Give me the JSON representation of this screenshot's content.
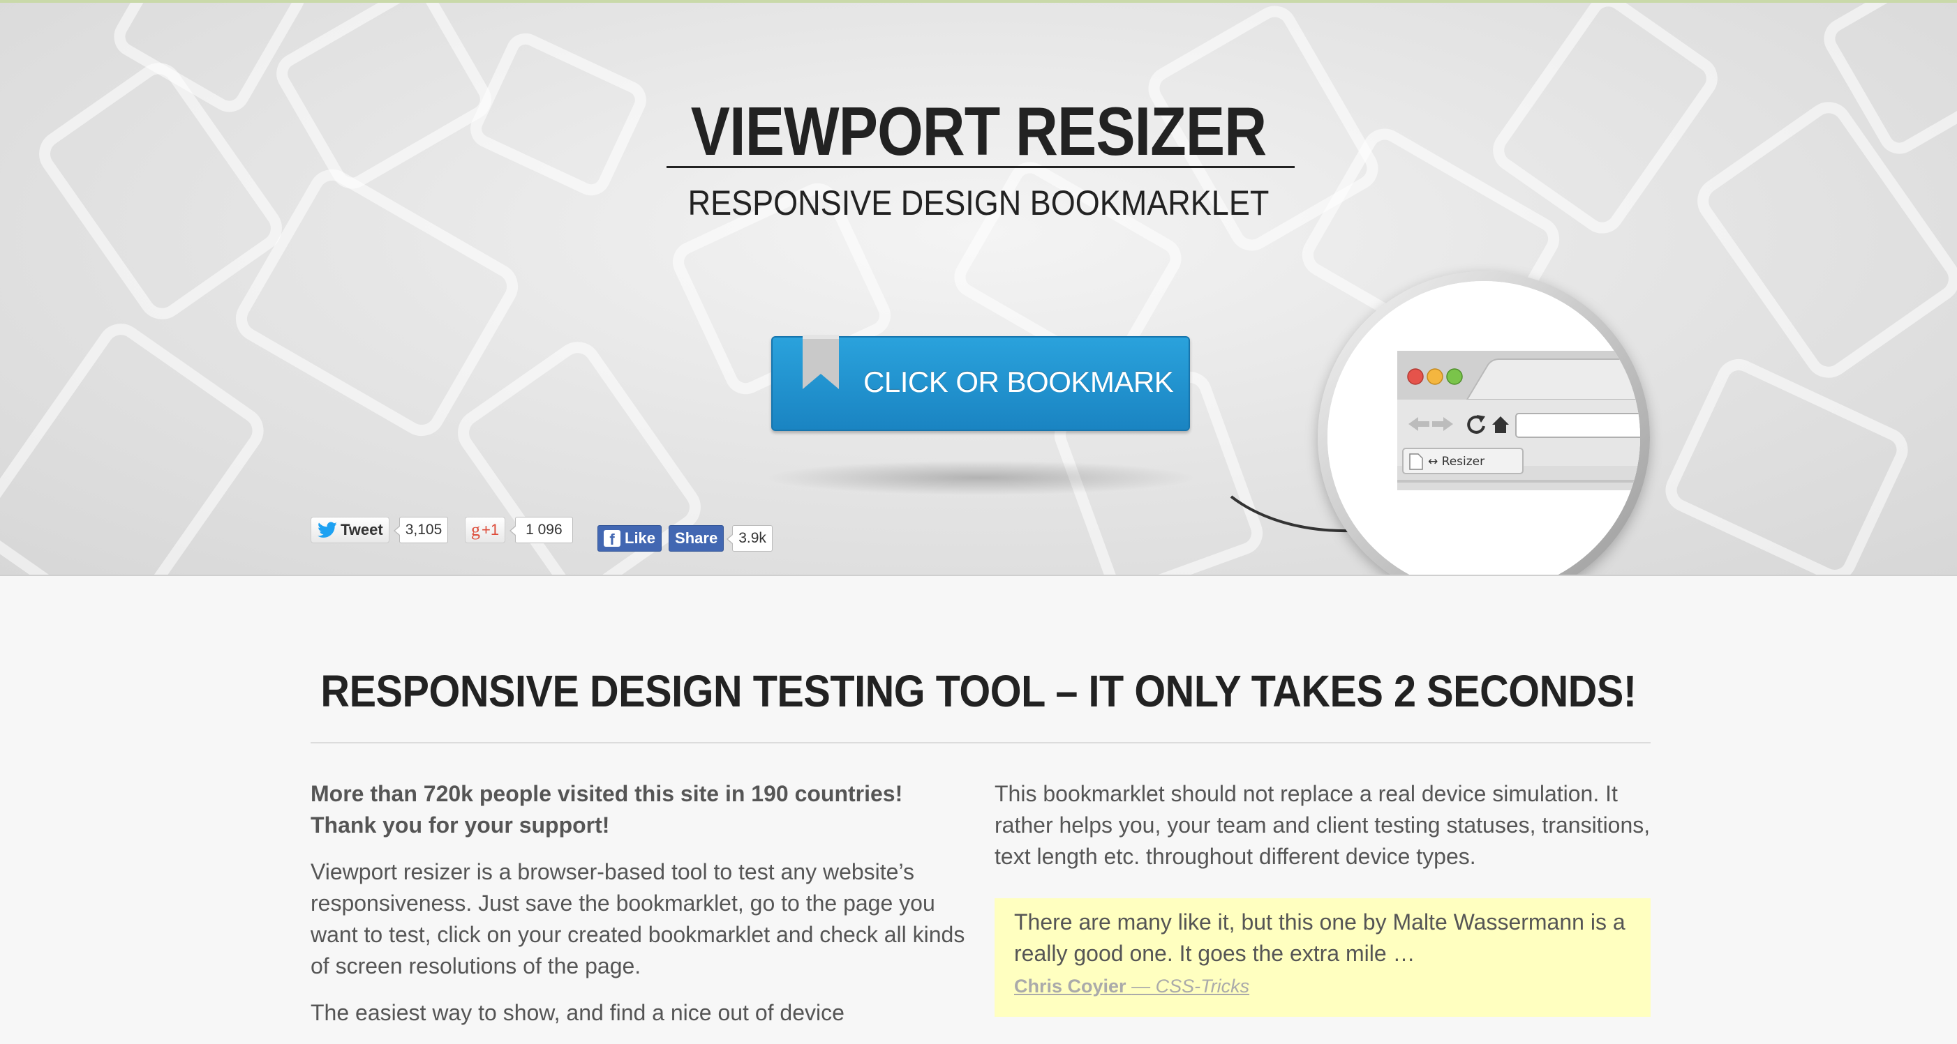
{
  "hero": {
    "title": "VIEWPORT RESIZER",
    "subtitle": "RESPONSIVE DESIGN BOOKMARKLET",
    "cta_label": "CLICK OR BOOKMARK"
  },
  "social": {
    "tweet_label": "Tweet",
    "tweet_count": "3,105",
    "gplus_label": "+1",
    "gplus_count": "1 096",
    "fb_like_label": "Like",
    "fb_share_label": "Share",
    "fb_count": "3.9k"
  },
  "browser_mock": {
    "bookmark_label": "↔ Resizer"
  },
  "content": {
    "heading": "RESPONSIVE DESIGN TESTING TOOL – IT ONLY TAKES 2 SECONDS!",
    "left_bold_1": "More than 720k people visited this site in 190 countries!",
    "left_bold_2": "Thank you for your support!",
    "left_para": "Viewport resizer is a browser-based tool to test any website’s responsiveness. Just save the bookmarklet, go to the page you want to test, click on your created bookmarklet and check all kinds of screen resolutions of the page.",
    "left_para_2": "The easiest way to show, and find a nice out of device",
    "right_para": "This bookmarklet should not replace a real device simulation. It rather helps you, your team and client testing statuses, transitions, text length etc. throughout different device types.",
    "quote_text": "There are many like it, but this one by Malte Wassermann is a really good one. It goes the extra mile …",
    "quote_author": "Chris Coyier",
    "quote_source": "— CSS-Tricks"
  },
  "colors": {
    "cta_blue": "#1e90cf",
    "quote_bg": "#ffffc0",
    "facebook_blue": "#4267b2"
  }
}
